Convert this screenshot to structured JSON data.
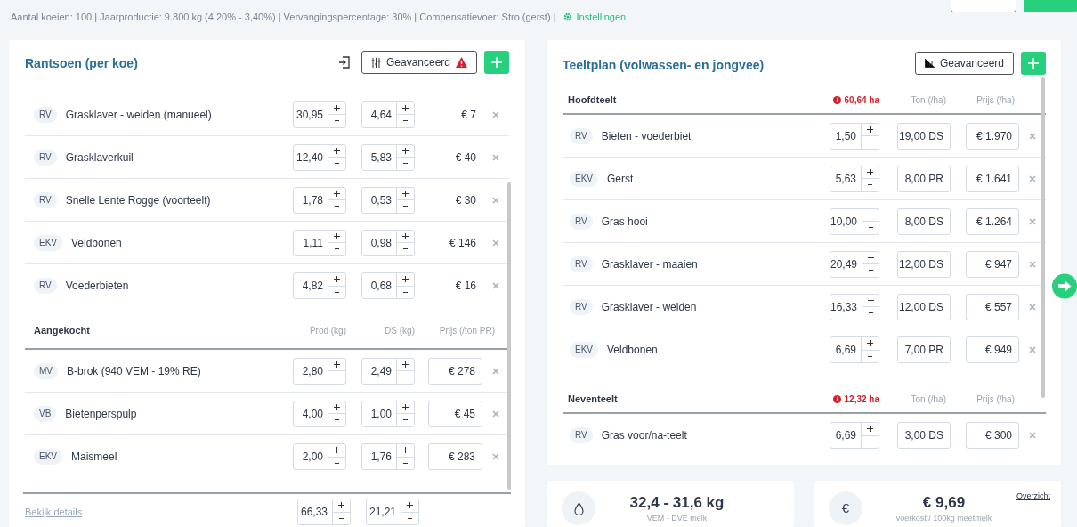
{
  "info_bar": {
    "text": "Aantal koeien: 100 | Jaarproductie:  9.800 kg (4,20% - 3,40%) | Vervangingspercentage: 30% | Compensatievoer: Stro (gerst) |",
    "settings_link": "Instellingen"
  },
  "rantsoen": {
    "title": "Rantsoen (per koe)",
    "advanced_button": {
      "label": "Geavanceerd",
      "warning": true
    },
    "sections": [
      {
        "kind": "text",
        "rows": [
          {
            "tag": "RV",
            "name": "Grasklaver - weiden (manueel)",
            "prod": "30,95",
            "ds": "4,64",
            "price": "€ 7"
          },
          {
            "tag": "RV",
            "name": "Grasklaverkuil",
            "prod": "12,40",
            "ds": "5,83",
            "price": "€ 40"
          },
          {
            "tag": "RV",
            "name": "Snelle Lente Rogge (voorteelt)",
            "prod": "1,78",
            "ds": "0,53",
            "price": "€ 30"
          },
          {
            "tag": "EKV",
            "name": "Veldbonen",
            "prod": "1,11",
            "ds": "0,98",
            "price": "€ 146"
          },
          {
            "tag": "RV",
            "name": "Voederbieten",
            "prod": "4,82",
            "ds": "0,68",
            "price": "€ 16"
          }
        ]
      },
      {
        "kind": "field",
        "title": "Aangekocht",
        "columns": [
          "Prod (kg)",
          "DS (kg)",
          "Prijs (/ton PR)"
        ],
        "rows": [
          {
            "tag": "MV",
            "name": "B-brok (940 VEM - 19% RE)",
            "prod": "2,80",
            "ds": "2,49",
            "price": "€ 278"
          },
          {
            "tag": "VB",
            "name": "Bietenperspulp",
            "prod": "4,00",
            "ds": "1,00",
            "price": "€ 45"
          },
          {
            "tag": "EKV",
            "name": "Maismeel",
            "prod": "2,00",
            "ds": "1,76",
            "price": "€ 283"
          }
        ]
      }
    ],
    "footer": {
      "link": "Bekijk details",
      "prod_total": "66,33",
      "ds_total": "21,21"
    }
  },
  "teeltplan": {
    "title": "Teeltplan (volwassen- en jongvee)",
    "advanced_button": {
      "label": "Geavanceerd"
    },
    "sections": [
      {
        "title": "Hoofdteelt",
        "area": "60,64 ha",
        "columns": [
          "Ton (/ha)",
          "Prijs (/ha)"
        ],
        "rows": [
          {
            "tag": "RV",
            "name": "Bieten - voederbiet",
            "ha": "1,50",
            "yield": "19,00 DS",
            "price": "€ 1.970"
          },
          {
            "tag": "EKV",
            "name": "Gerst",
            "ha": "5,63",
            "yield": "8,00 PR",
            "price": "€ 1.641"
          },
          {
            "tag": "RV",
            "name": "Gras hooi",
            "ha": "10,00",
            "yield": "8,00 DS",
            "price": "€ 1.264"
          },
          {
            "tag": "RV",
            "name": "Grasklaver - maaien",
            "ha": "20,49",
            "yield": "12,00 DS",
            "price": "€ 947"
          },
          {
            "tag": "RV",
            "name": "Grasklaver - weiden",
            "ha": "16,33",
            "yield": "12,00 DS",
            "price": "€ 557"
          },
          {
            "tag": "EKV",
            "name": "Veldbonen",
            "ha": "6,69",
            "yield": "7,00 PR",
            "price": "€ 949"
          }
        ]
      },
      {
        "title": "Neventeelt",
        "area": "12,32 ha",
        "columns": [
          "Ton (/ha)",
          "Prijs (/ha)"
        ],
        "rows": [
          {
            "tag": "RV",
            "name": "Gras voor/na-teelt",
            "ha": "6,69",
            "yield": "3,00 DS",
            "price": "€ 300"
          }
        ]
      }
    ]
  },
  "stats": [
    {
      "kind": "drop",
      "value": "32,4 - 31,6 kg",
      "label": "VEM - DVE melk"
    },
    {
      "kind": "glyph",
      "glyph": "€",
      "value": "€ 9,69",
      "label": "voerkost / 100kg meetmelk",
      "link": "Overzicht"
    }
  ]
}
